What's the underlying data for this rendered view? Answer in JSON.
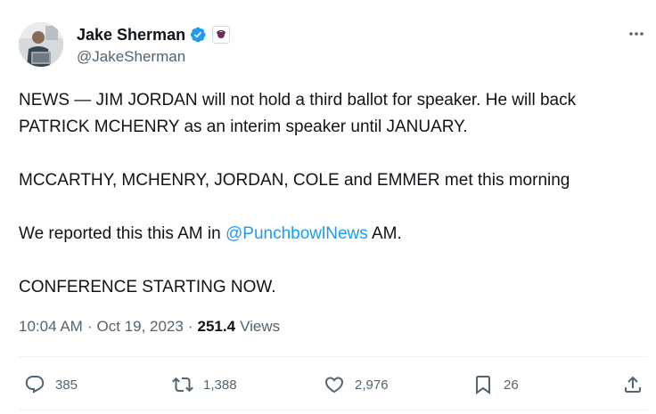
{
  "author": {
    "display_name": "Jake Sherman",
    "handle": "@JakeSherman"
  },
  "tweet": {
    "line1": "NEWS — JIM JORDAN will not hold a third ballot for speaker. He will back",
    "line2": "PATRICK MCHENRY as an interim speaker until JANUARY.",
    "line3": "MCCARTHY, MCHENRY, JORDAN, COLE and EMMER met this morning",
    "line4_before": "We reported this this AM in ",
    "line4_mention": "@PunchbowlNews",
    "line4_after": " AM.",
    "line5": "CONFERENCE STARTING NOW."
  },
  "meta": {
    "time": "10:04 AM",
    "date": "Oct 19, 2023",
    "separator": "·",
    "views_count": "251.4",
    "views_label": "Views"
  },
  "actions": {
    "replies": "385",
    "reposts": "1,388",
    "likes": "2,976",
    "bookmarks": "26"
  },
  "icons": {
    "more": "more-dots-icon",
    "verified": "verified-badge-icon",
    "affiliation": "affiliation-badge-icon",
    "reply": "reply-icon",
    "repost": "repost-icon",
    "like": "heart-icon",
    "bookmark": "bookmark-icon",
    "share": "share-icon"
  },
  "colors": {
    "accent": "#1d9bf0",
    "text": "#0f1419",
    "secondary": "#536471",
    "divider": "#eff3f4"
  }
}
